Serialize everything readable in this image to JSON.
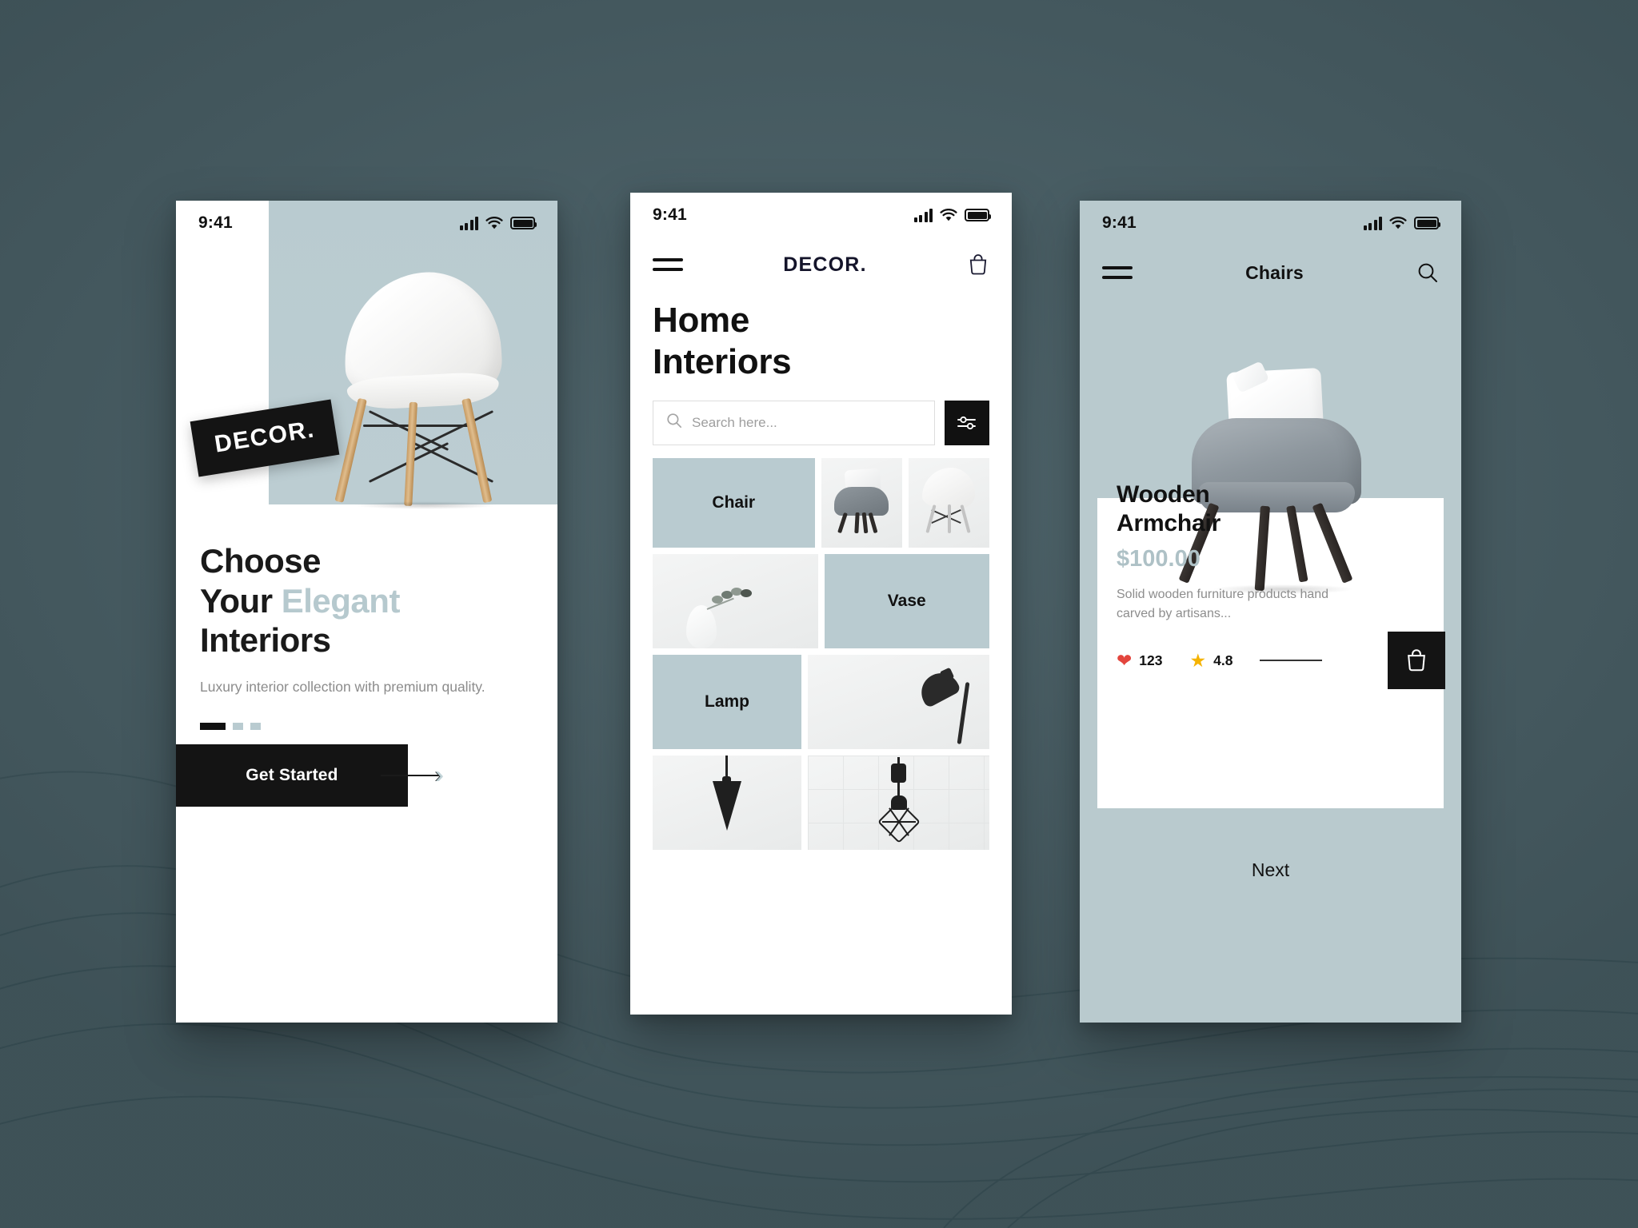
{
  "theme": {
    "background": "#4a6168",
    "accent_blue": "#b9cbd0",
    "ink": "#141414",
    "muted_text": "#8c8c8c",
    "heart_red": "#e3453d",
    "star_yellow": "#f5b301"
  },
  "status_bar": {
    "time": "9:41",
    "icons": [
      "signal-bars-icon",
      "wifi-icon",
      "battery-icon"
    ]
  },
  "screen1": {
    "logo_badge": "DECOR.",
    "title_line1": "Choose",
    "title_line2_plain": "Your ",
    "title_line2_accent": "Elegant",
    "title_line3": "Interiors",
    "subtitle": "Luxury interior collection with premium quality.",
    "pagination": {
      "total": 3,
      "active_index": 0
    },
    "cta_label": "Get Started",
    "hero_image_alt": "white-eames-chair"
  },
  "screen2": {
    "menu_icon": "hamburger-menu-icon",
    "brand": "DECOR.",
    "cart_icon": "shopping-bag-icon",
    "heading_line1": "Home",
    "heading_line2": "Interiors",
    "search": {
      "placeholder": "Search here...",
      "value": "",
      "icon": "search-icon"
    },
    "filter_icon": "sliders-filter-icon",
    "grid": [
      [
        {
          "type": "label",
          "label": "Chair",
          "span": 2
        },
        {
          "type": "image",
          "alt": "grey-armchair",
          "span": 1
        },
        {
          "type": "image",
          "alt": "white-eames-chair",
          "span": 1
        }
      ],
      [
        {
          "type": "image",
          "alt": "white-vase-with-eucalyptus",
          "span": 2
        },
        {
          "type": "label",
          "label": "Vase",
          "span": 2
        }
      ],
      [
        {
          "type": "label",
          "label": "Lamp",
          "span": 2
        },
        {
          "type": "image",
          "alt": "black-desk-lamp",
          "span": 2
        }
      ],
      [
        {
          "type": "image",
          "alt": "black-cone-pendant-lamp",
          "span": 2
        },
        {
          "type": "image",
          "alt": "black-cage-pendant-lamp",
          "span": 2
        }
      ]
    ]
  },
  "screen3": {
    "menu_icon": "hamburger-menu-icon",
    "title": "Chairs",
    "search_icon": "search-icon",
    "product": {
      "image_alt": "grey-wooden-armchair-with-pillow",
      "name_line1": "Wooden",
      "name_line2": "Armchair",
      "price": "$100.00",
      "description": "Solid wooden furniture products hand carved by artisans...",
      "likes": "123",
      "likes_icon": "heart-icon",
      "rating": "4.8",
      "rating_icon": "star-icon",
      "cart_icon": "shopping-bag-icon"
    },
    "next_label": "Next"
  }
}
